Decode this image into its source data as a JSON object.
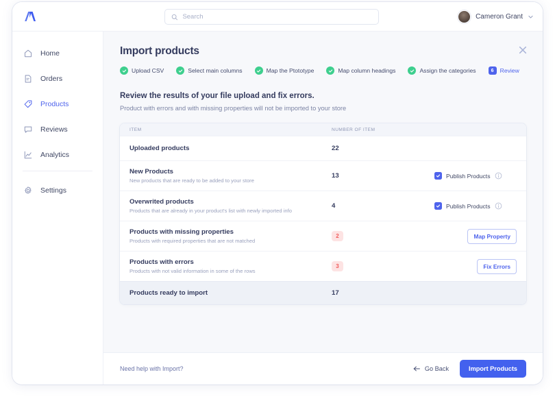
{
  "topbar": {
    "logo_icon": "brand-logo-icon",
    "search": {
      "placeholder": "Search",
      "value": "",
      "icon": "search-icon"
    },
    "user": {
      "name": "Cameron Grant",
      "avatar_icon": "user-avatar",
      "chevron_icon": "chevron-down-icon"
    }
  },
  "sidebar": {
    "items": [
      {
        "label": "Home",
        "icon": "home-icon",
        "active": false
      },
      {
        "label": "Orders",
        "icon": "orders-icon",
        "active": false
      },
      {
        "label": "Products",
        "icon": "tag-icon",
        "active": true
      },
      {
        "label": "Reviews",
        "icon": "chat-icon",
        "active": false
      },
      {
        "label": "Analytics",
        "icon": "analytics-icon",
        "active": false
      }
    ],
    "footer_items": [
      {
        "label": "Settings",
        "icon": "gear-icon",
        "active": false
      }
    ]
  },
  "main": {
    "title": "Import products",
    "close_icon": "close-icon",
    "steps": [
      {
        "label": "Upload CSV",
        "state": "done",
        "number": "1"
      },
      {
        "label": "Select main columns",
        "state": "done",
        "number": "2"
      },
      {
        "label": "Map the Ptototype",
        "state": "done",
        "number": "3"
      },
      {
        "label": "Map column headings",
        "state": "done",
        "number": "4"
      },
      {
        "label": "Assign the categories",
        "state": "done",
        "number": "5"
      },
      {
        "label": "Review",
        "state": "current",
        "number": "6"
      }
    ],
    "section_title": "Review the results of your file upload and fix errors.",
    "section_subtitle": "Product with errors and with missing properties will not be imported to your store",
    "table": {
      "columns": [
        "ITEM",
        "NUMBER OF ITEM"
      ],
      "rows": [
        {
          "name": "Uploaded products",
          "desc": "",
          "count": "22",
          "count_type": "plain",
          "action": "none"
        },
        {
          "name": "New Products",
          "desc": "New products that are ready to be added to your store",
          "count": "13",
          "count_type": "plain",
          "action": "checkbox",
          "checkbox_label": "Publish Products",
          "checkbox_checked": true,
          "info_icon": "info-icon"
        },
        {
          "name": "Overwrited products",
          "desc": "Products that are already in your product's list with newly imported info",
          "count": "4",
          "count_type": "plain",
          "action": "checkbox",
          "checkbox_label": "Publish Products",
          "checkbox_checked": true,
          "info_icon": "info-icon"
        },
        {
          "name": "Products with missing properties",
          "desc": "Products with required properties that are not matched",
          "count": "2",
          "count_type": "badge",
          "action": "button",
          "button_label": "Map Property"
        },
        {
          "name": "Products with errors",
          "desc": "Products with not valid information in some of the rows",
          "count": "3",
          "count_type": "badge",
          "action": "button",
          "button_label": "Fix Errors"
        },
        {
          "name": "Products ready to import",
          "desc": "",
          "count": "17",
          "count_type": "plain",
          "action": "none",
          "summary": true
        }
      ]
    }
  },
  "footer": {
    "help_label": "Need help with Import?",
    "back_label": "Go Back",
    "back_icon": "arrow-left-icon",
    "primary_label": "Import Products"
  },
  "colors": {
    "accent": "#4361ee",
    "accent_link": "#4e63ec",
    "success": "#3ecf8e",
    "danger": "#f05a5a",
    "danger_bg": "#fde3e3",
    "page_bg": "#f7f8fb",
    "text": "#343b5e",
    "muted": "#9aa1bd"
  }
}
